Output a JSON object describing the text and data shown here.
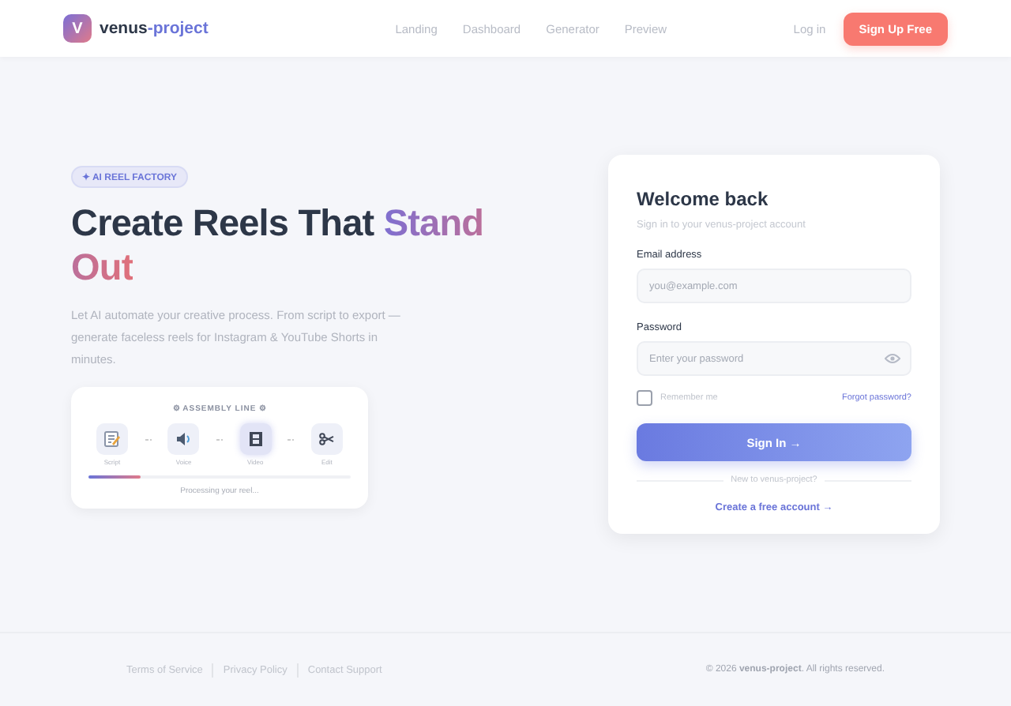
{
  "nav": {
    "logo_letter": "V",
    "brand_name": "venus",
    "brand_accent": "-project",
    "links": [
      "Landing",
      "Dashboard",
      "Generator",
      "Preview"
    ],
    "login": "Log in",
    "signup": "Sign Up Free"
  },
  "hero": {
    "badge": "✦ AI REEL FACTORY",
    "headline_plain": "Create Reels That ",
    "headline_accent": "Stand Out",
    "description": "Let AI automate your creative process. From script to export — generate faceless reels for Instagram & YouTube Shorts in minutes.",
    "assembly": {
      "title": "⚙ ASSEMBLY LINE ⚙",
      "steps": [
        {
          "kind": "script",
          "label": "Script",
          "active": false
        },
        {
          "kind": "voice",
          "label": "Voice",
          "active": false
        },
        {
          "kind": "video",
          "label": "Video",
          "active": true
        },
        {
          "kind": "edit",
          "label": "Edit",
          "active": false
        }
      ],
      "level": 0.2,
      "status": "Processing your reel..."
    }
  },
  "login": {
    "title": "Welcome back",
    "subtitle": "Sign in to your venus-project account",
    "email_label": "Email address",
    "email_placeholder": "you@example.com",
    "password_label": "Password",
    "password_placeholder": "Enter your password",
    "remember_label": "Remember me",
    "remember_checked": false,
    "forgot": "Forgot password?",
    "submit": "Sign In →",
    "divider_text": "New to venus-project?",
    "create": "Create a free account →"
  },
  "footer": {
    "links": [
      "Terms of Service",
      "Privacy Policy",
      "Contact Support"
    ],
    "copyright": "© 2026 **venus-project**. All rights reserved."
  }
}
